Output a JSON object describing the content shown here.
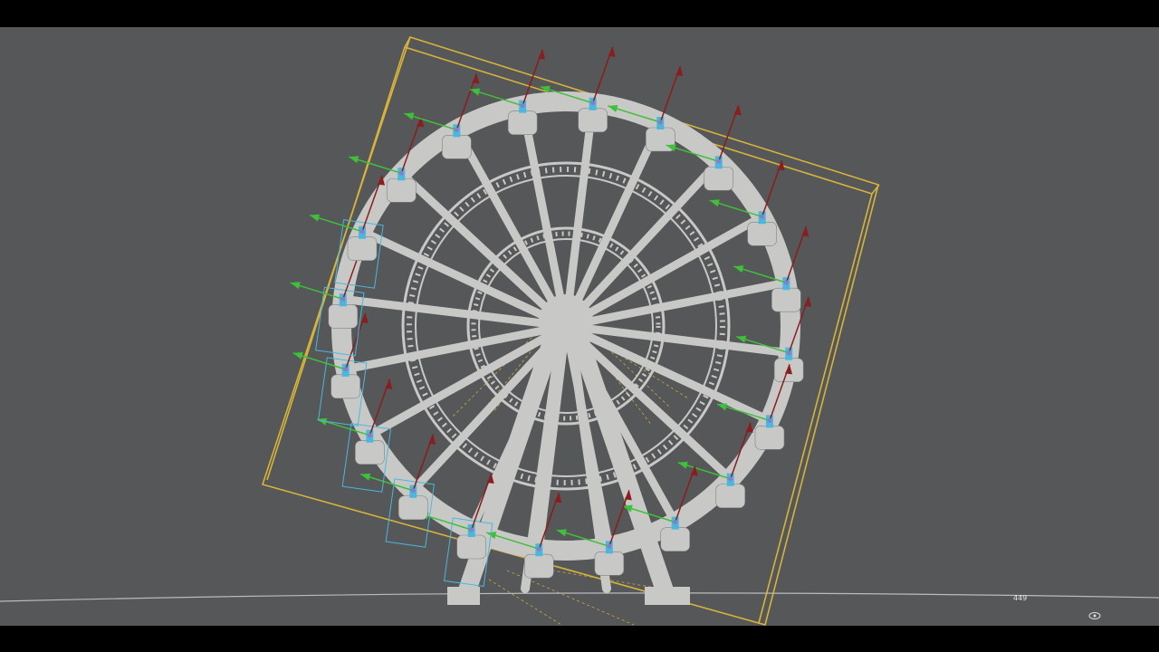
{
  "viewport": {
    "background": "#555759",
    "frame_readout": "449"
  },
  "scene": {
    "object": "ferris-wheel",
    "gondola_count": 20,
    "colors": {
      "geometry": "#c8c9c6",
      "bounding_box": "#d8b43a",
      "selection": "#4ab8de",
      "axis_up": "#8a1d1d",
      "axis_side": "#3fbf3a",
      "pivot": "#8f79c9",
      "ground_line": "#b9bbbd"
    }
  },
  "icons": {
    "nav_gizmo": "view-cube-icon"
  }
}
